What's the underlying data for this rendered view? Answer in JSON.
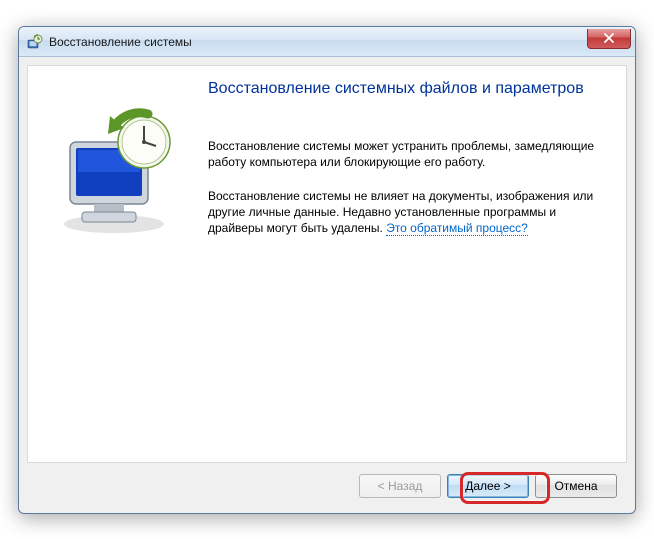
{
  "window": {
    "title": "Восстановление системы"
  },
  "content": {
    "heading": "Восстановление системных файлов и параметров",
    "paragraph1": "Восстановление системы может устранить проблемы, замедляющие работу компьютера или блокирующие его работу.",
    "paragraph2_prefix": "Восстановление системы не влияет на документы, изображения или другие личные данные. Недавно установленные программы и драйверы могут быть удалены. ",
    "paragraph2_link": "Это обратимый процесс?"
  },
  "buttons": {
    "back": "< Назад",
    "next": "Далее >",
    "cancel": "Отмена"
  }
}
